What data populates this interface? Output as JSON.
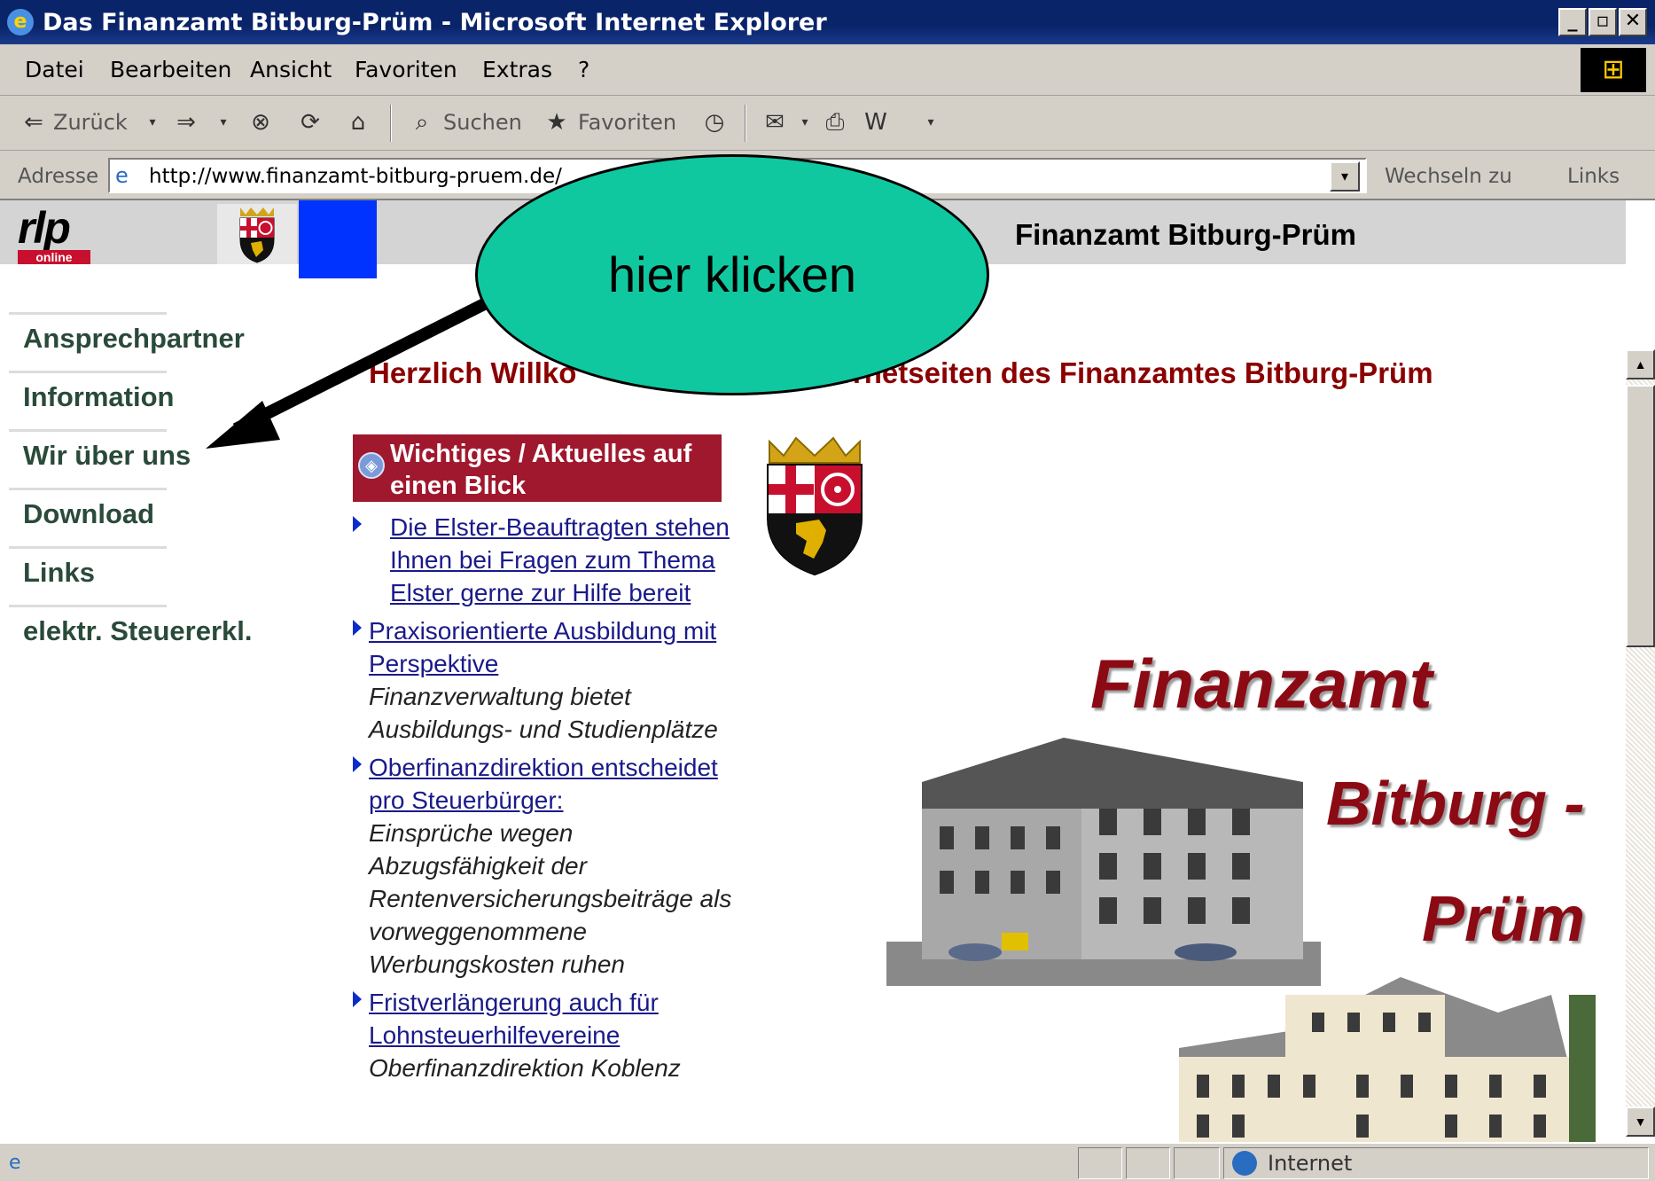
{
  "window": {
    "title": "Das Finanzamt Bitburg-Prüm - Microsoft Internet Explorer"
  },
  "menubar": {
    "items": [
      "Datei",
      "Bearbeiten",
      "Ansicht",
      "Favoriten",
      "Extras",
      "?"
    ]
  },
  "toolbar": {
    "back_label": "Zurück",
    "search_label": "Suchen",
    "favorites_label": "Favoriten"
  },
  "addressbar": {
    "label": "Adresse",
    "url": "http://www.finanzamt-bitburg-pruem.de/",
    "go_label": "Wechseln zu",
    "links_label": "Links"
  },
  "page": {
    "logo_text": "rlp",
    "logo_sub": "online",
    "site_title": "Finanzamt Bitburg-Prüm",
    "welcome_left": "Herzlich Willko",
    "welcome_right": "nternetseiten des Finanzamtes Bitburg-Prüm",
    "nav": [
      "Ansprechpartner",
      "Information",
      "Wir über uns",
      "Download",
      "Links",
      "elektr. Steuererkl."
    ],
    "news_header": "Wichtiges / Aktuelles auf einen Blick",
    "news": [
      {
        "link": "Die Elster-Beauftragten stehen Ihnen bei Fragen zum Thema Elster gerne zur Hilfe bereit",
        "desc": ""
      },
      {
        "link": "Praxisorientierte Ausbildung mit Perspektive",
        "desc": "Finanzverwaltung bietet Ausbildungs- und Studienplätze"
      },
      {
        "link": "Oberfinanzdirektion entscheidet pro Steuerbürger:",
        "desc": "Einsprüche wegen Abzugsfähigkeit der Rentenversicherungsbeiträge als vorweggenommene Werbungskosten ruhen"
      },
      {
        "link": "Fristverlängerung auch für Lohnsteuerhilfevereine",
        "desc": "Oberfinanzdirektion Koblenz"
      }
    ],
    "banner_line1": "Finanzamt",
    "banner_line2": "Bitburg -",
    "banner_line3": "Prüm"
  },
  "callout": {
    "text": "hier klicken"
  },
  "statusbar": {
    "zone": "Internet"
  },
  "colors": {
    "title_bar": "#0a246a",
    "chrome": "#d4d0c8",
    "news_header": "#a0182e",
    "welcome_text": "#8b0000",
    "callout": "#10c8a0"
  }
}
